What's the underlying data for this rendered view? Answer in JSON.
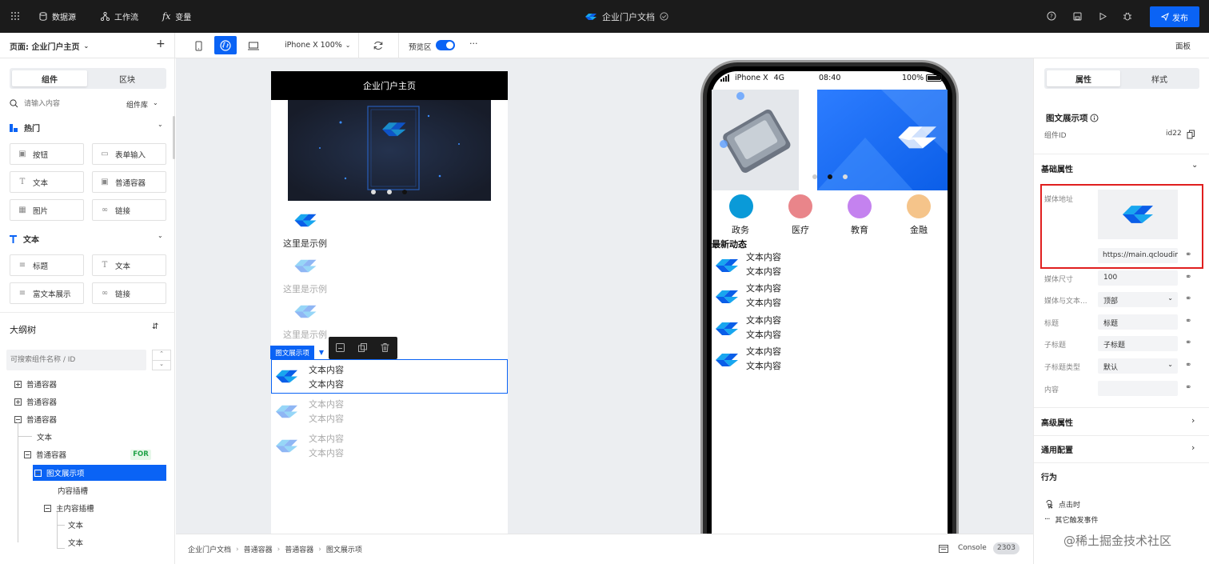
{
  "topbar": {
    "menu": [
      "数据源",
      "工作流",
      "变量"
    ],
    "doc_title": "企业门户文档",
    "publish": "发布"
  },
  "toolbar": {
    "page_label": "页面: 企业门户主页",
    "device": "iPhone X 100%",
    "preview_label": "预览区",
    "more": "···",
    "panel_label": "面板"
  },
  "left": {
    "tabs": [
      "组件",
      "区块"
    ],
    "search_placeholder": "请输入内容",
    "library": "组件库",
    "section_hot": "热门",
    "hot_items": [
      "按钮",
      "表单输入",
      "文本",
      "普通容器",
      "图片",
      "链接"
    ],
    "section_text": "文本",
    "text_items": [
      "标题",
      "文本",
      "富文本展示",
      "链接"
    ],
    "outline_title": "大纲树",
    "outline_search": "可搜索组件名称 / ID",
    "tree": [
      "普通容器",
      "普通容器",
      "普通容器",
      "文本",
      "普通容器",
      "图文展示项",
      "内容插槽",
      "主内容插槽",
      "文本",
      "文本"
    ],
    "for_badge": "FOR"
  },
  "canvas": {
    "page_title": "企业门户主页",
    "sample_text": "这里是示例",
    "selected_tag": "图文展示项",
    "content_text": "文本内容"
  },
  "phone": {
    "carrier": "iPhone X",
    "network": "4G",
    "time": "08:40",
    "battery": "100%",
    "categories": [
      {
        "label": "政务",
        "color": "#0a9ad8"
      },
      {
        "label": "医疗",
        "color": "#e9858a"
      },
      {
        "label": "教育",
        "color": "#c482ef"
      },
      {
        "label": "金融",
        "color": "#f5c48a"
      }
    ],
    "news_title": "最新动态",
    "content_text": "文本内容"
  },
  "statusbar": {
    "breadcrumb": [
      "企业门户文档",
      "普通容器",
      "普通容器",
      "图文展示项"
    ],
    "console": "Console",
    "console_count": "2303",
    "watermark": "@稀土掘金技术社区"
  },
  "right": {
    "tabs": [
      "属性",
      "样式"
    ],
    "comp_title": "图文展示项",
    "id_label": "组件ID",
    "id_value": "id22",
    "basic": "基础属性",
    "media_label": "媒体地址",
    "media_url": "https://main.qcloudim",
    "rows": [
      {
        "label": "媒体尺寸",
        "value": "100",
        "dropdown": false
      },
      {
        "label": "媒体与文本...",
        "value": "顶部",
        "dropdown": true
      },
      {
        "label": "标题",
        "value": "标题",
        "dropdown": false
      },
      {
        "label": "子标题",
        "value": "子标题",
        "dropdown": false
      },
      {
        "label": "子标题类型",
        "value": "默认",
        "dropdown": true
      },
      {
        "label": "内容",
        "value": "",
        "dropdown": false
      }
    ],
    "advanced": "高级属性",
    "general": "通用配置",
    "behavior": "行为",
    "click_event": "点击时",
    "other_event": "其它触发事件"
  }
}
